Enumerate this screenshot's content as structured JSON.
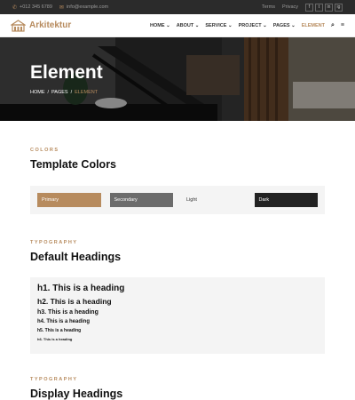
{
  "topbar": {
    "phone": "+012 345 6789",
    "email": "info@example.com",
    "links": [
      "Terms",
      "Privacy"
    ],
    "social": [
      "f",
      "t",
      "in",
      "ig"
    ]
  },
  "brand": {
    "name": "Arkitektur",
    "logo_icon": "building-logo-icon"
  },
  "nav": {
    "items": [
      "HOME",
      "ABOUT",
      "SERVICE",
      "PROJECT",
      "PAGES"
    ],
    "active": "ELEMENT",
    "search_icon": "search-icon",
    "menu_icon": "hamburger-icon"
  },
  "hero": {
    "title": "Element",
    "breadcrumb": [
      "HOME",
      "PAGES"
    ],
    "breadcrumb_current": "ELEMENT"
  },
  "colors_section": {
    "eyebrow": "COLORS",
    "title": "Template Colors",
    "swatches": [
      {
        "label": "Primary",
        "bg": "#b78b5e",
        "fg": "#ffffff"
      },
      {
        "label": "Secondary",
        "bg": "#6c6c6c",
        "fg": "#ffffff"
      },
      {
        "label": "Light",
        "bg": "#f4f4f4",
        "fg": "#333333"
      },
      {
        "label": "Dark",
        "bg": "#222222",
        "fg": "#ffffff"
      }
    ]
  },
  "typography_section": {
    "eyebrow": "TYPOGRAPHY",
    "title": "Default Headings",
    "headings": [
      "h1. This is a heading",
      "h2. This is a heading",
      "h3. This is a heading",
      "h4. This is a heading",
      "h5. This is a heading",
      "h6. This is a heading"
    ]
  },
  "display_section": {
    "eyebrow": "TYPOGRAPHY",
    "title": "Display Headings"
  },
  "colors": {
    "accent": "#b78b5e",
    "topbar_bg": "#2b2b2b",
    "light_bg": "#f4f4f4"
  }
}
